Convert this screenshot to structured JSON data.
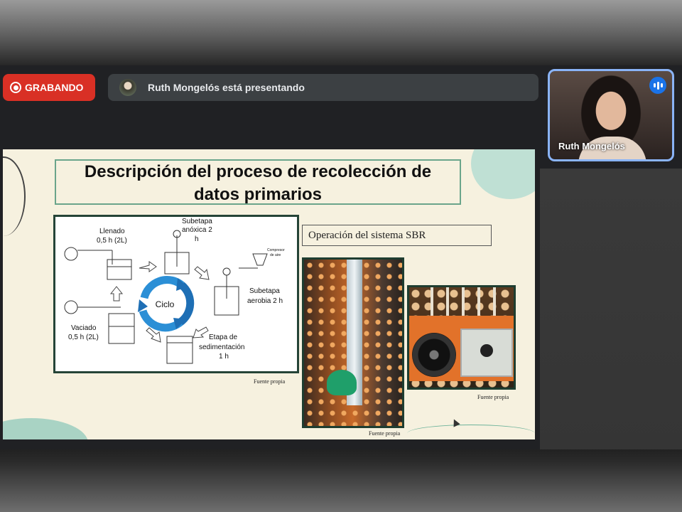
{
  "meeting": {
    "recording_label": "GRABANDO",
    "presenter_banner": "Ruth Mongelós está presentando",
    "self_view_name": "Ruth Mongelós"
  },
  "slide": {
    "title_line1": "Descripción del proceso de recolección de",
    "title_line2": "datos primarios",
    "operation_label": "Operación del sistema SBR",
    "caption1": "Fuente propia",
    "caption2": "Fuente propia",
    "caption3": "Fuente propia",
    "diagram": {
      "center": "Ciclo",
      "fill_l1": "Llenado",
      "fill_l2": "0,5 h (2L)",
      "anox_l1": "Subetapa",
      "anox_l2": "anóxica 2",
      "anox_l3": "h",
      "compressor_l1": "Compresor",
      "compressor_l2": "de aire",
      "aer_l1": "Subetapa",
      "aer_l2": "aerobia 2 h",
      "sed_l1": "Etapa de",
      "sed_l2": "sedimentación",
      "sed_l3": "1 h",
      "empty_l1": "Vaciado",
      "empty_l2": "0,5 h (2L)"
    }
  },
  "colors": {
    "recording": "#d93025",
    "cycle_arrow": "#2b8fd6",
    "slide_bg": "#f6f1df",
    "accent_green": "#6aa58b"
  }
}
